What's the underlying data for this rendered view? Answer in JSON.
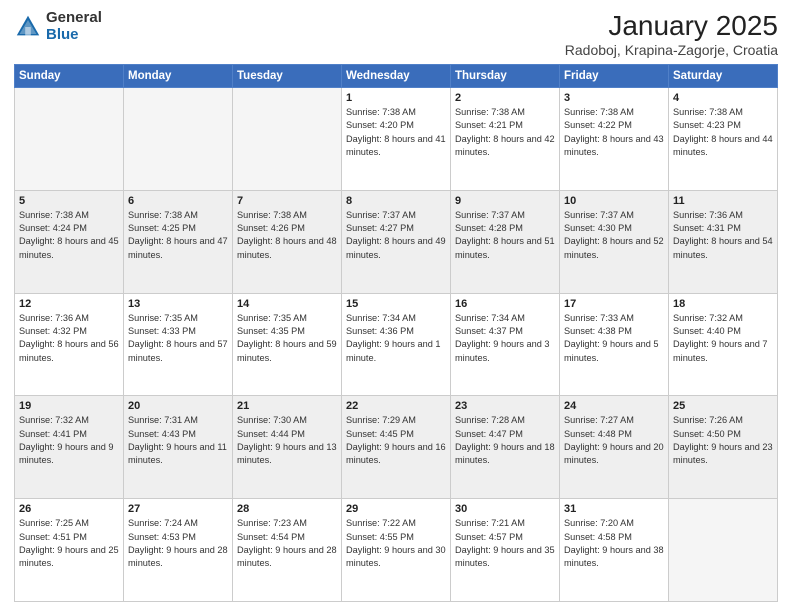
{
  "header": {
    "logo_general": "General",
    "logo_blue": "Blue",
    "title": "January 2025",
    "location": "Radoboj, Krapina-Zagorje, Croatia"
  },
  "days_of_week": [
    "Sunday",
    "Monday",
    "Tuesday",
    "Wednesday",
    "Thursday",
    "Friday",
    "Saturday"
  ],
  "weeks": [
    [
      {
        "day": "",
        "text": ""
      },
      {
        "day": "",
        "text": ""
      },
      {
        "day": "",
        "text": ""
      },
      {
        "day": "1",
        "text": "Sunrise: 7:38 AM\nSunset: 4:20 PM\nDaylight: 8 hours and 41 minutes."
      },
      {
        "day": "2",
        "text": "Sunrise: 7:38 AM\nSunset: 4:21 PM\nDaylight: 8 hours and 42 minutes."
      },
      {
        "day": "3",
        "text": "Sunrise: 7:38 AM\nSunset: 4:22 PM\nDaylight: 8 hours and 43 minutes."
      },
      {
        "day": "4",
        "text": "Sunrise: 7:38 AM\nSunset: 4:23 PM\nDaylight: 8 hours and 44 minutes."
      }
    ],
    [
      {
        "day": "5",
        "text": "Sunrise: 7:38 AM\nSunset: 4:24 PM\nDaylight: 8 hours and 45 minutes."
      },
      {
        "day": "6",
        "text": "Sunrise: 7:38 AM\nSunset: 4:25 PM\nDaylight: 8 hours and 47 minutes."
      },
      {
        "day": "7",
        "text": "Sunrise: 7:38 AM\nSunset: 4:26 PM\nDaylight: 8 hours and 48 minutes."
      },
      {
        "day": "8",
        "text": "Sunrise: 7:37 AM\nSunset: 4:27 PM\nDaylight: 8 hours and 49 minutes."
      },
      {
        "day": "9",
        "text": "Sunrise: 7:37 AM\nSunset: 4:28 PM\nDaylight: 8 hours and 51 minutes."
      },
      {
        "day": "10",
        "text": "Sunrise: 7:37 AM\nSunset: 4:30 PM\nDaylight: 8 hours and 52 minutes."
      },
      {
        "day": "11",
        "text": "Sunrise: 7:36 AM\nSunset: 4:31 PM\nDaylight: 8 hours and 54 minutes."
      }
    ],
    [
      {
        "day": "12",
        "text": "Sunrise: 7:36 AM\nSunset: 4:32 PM\nDaylight: 8 hours and 56 minutes."
      },
      {
        "day": "13",
        "text": "Sunrise: 7:35 AM\nSunset: 4:33 PM\nDaylight: 8 hours and 57 minutes."
      },
      {
        "day": "14",
        "text": "Sunrise: 7:35 AM\nSunset: 4:35 PM\nDaylight: 8 hours and 59 minutes."
      },
      {
        "day": "15",
        "text": "Sunrise: 7:34 AM\nSunset: 4:36 PM\nDaylight: 9 hours and 1 minute."
      },
      {
        "day": "16",
        "text": "Sunrise: 7:34 AM\nSunset: 4:37 PM\nDaylight: 9 hours and 3 minutes."
      },
      {
        "day": "17",
        "text": "Sunrise: 7:33 AM\nSunset: 4:38 PM\nDaylight: 9 hours and 5 minutes."
      },
      {
        "day": "18",
        "text": "Sunrise: 7:32 AM\nSunset: 4:40 PM\nDaylight: 9 hours and 7 minutes."
      }
    ],
    [
      {
        "day": "19",
        "text": "Sunrise: 7:32 AM\nSunset: 4:41 PM\nDaylight: 9 hours and 9 minutes."
      },
      {
        "day": "20",
        "text": "Sunrise: 7:31 AM\nSunset: 4:43 PM\nDaylight: 9 hours and 11 minutes."
      },
      {
        "day": "21",
        "text": "Sunrise: 7:30 AM\nSunset: 4:44 PM\nDaylight: 9 hours and 13 minutes."
      },
      {
        "day": "22",
        "text": "Sunrise: 7:29 AM\nSunset: 4:45 PM\nDaylight: 9 hours and 16 minutes."
      },
      {
        "day": "23",
        "text": "Sunrise: 7:28 AM\nSunset: 4:47 PM\nDaylight: 9 hours and 18 minutes."
      },
      {
        "day": "24",
        "text": "Sunrise: 7:27 AM\nSunset: 4:48 PM\nDaylight: 9 hours and 20 minutes."
      },
      {
        "day": "25",
        "text": "Sunrise: 7:26 AM\nSunset: 4:50 PM\nDaylight: 9 hours and 23 minutes."
      }
    ],
    [
      {
        "day": "26",
        "text": "Sunrise: 7:25 AM\nSunset: 4:51 PM\nDaylight: 9 hours and 25 minutes."
      },
      {
        "day": "27",
        "text": "Sunrise: 7:24 AM\nSunset: 4:53 PM\nDaylight: 9 hours and 28 minutes."
      },
      {
        "day": "28",
        "text": "Sunrise: 7:23 AM\nSunset: 4:54 PM\nDaylight: 9 hours and 28 minutes."
      },
      {
        "day": "29",
        "text": "Sunrise: 7:22 AM\nSunset: 4:55 PM\nDaylight: 9 hours and 30 minutes."
      },
      {
        "day": "30",
        "text": "Sunrise: 7:21 AM\nSunset: 4:57 PM\nDaylight: 9 hours and 35 minutes."
      },
      {
        "day": "31",
        "text": "Sunrise: 7:20 AM\nSunset: 4:58 PM\nDaylight: 9 hours and 38 minutes."
      },
      {
        "day": "",
        "text": ""
      }
    ]
  ]
}
